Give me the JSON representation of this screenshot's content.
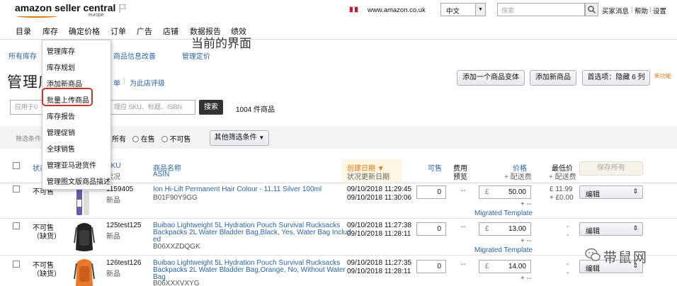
{
  "header": {
    "logo": "amazon seller central",
    "logo_sub": "europe",
    "site_url": "www.amazon.co.uk",
    "language": "中文",
    "search_placeholder": "搜索",
    "links": [
      "买家消息",
      "帮助",
      "设置"
    ],
    "accent_color": "#e47911"
  },
  "nav": [
    "目录",
    "库存",
    "确定价格",
    "订单",
    "广告",
    "店铺",
    "数据报告",
    "绩效"
  ],
  "annotation": "当前的界面",
  "subnav": [
    "所有库存",
    "商品信息改善",
    "管理定价"
  ],
  "dropdown": [
    "管理库存",
    "库存规划",
    "添加新商品",
    "批量上传商品",
    "库存报告",
    "管理促销",
    "全球销售",
    "管理亚马逊货件",
    "管理图文版商品描述"
  ],
  "page": {
    "title": "管理库存",
    "tab_link": "为此店评级",
    "partial_link": "单",
    "buttons": [
      "添加一个商品变体",
      "添加新商品",
      "首选项：隐藏 6 列"
    ],
    "legend_tag": "新功能",
    "search_placeholder": "理应 SKU、标题、ISBN",
    "search_prefix": "应用于0",
    "search_button": "搜索",
    "result_count": "1004 件商品"
  },
  "filter": {
    "label": "筛选条件",
    "options": [
      "所有",
      "在售",
      "不可售"
    ],
    "more_button": "其他筛选条件"
  },
  "columns": {
    "status": "状态",
    "sku": "SKU",
    "sku_sub": "状况",
    "name": "商品名称",
    "asin": "ASIN",
    "created": "创建日期",
    "created_sub": "状况更新日期",
    "available": "可售",
    "fee1": "费用",
    "fee2": "预览",
    "price": "价格",
    "price_sub": "+ 配送费",
    "lowest": "最低价",
    "lowest_sub": "+ 配送费",
    "save": "保存所有"
  },
  "rows": [
    {
      "status": "不可售",
      "status2": "",
      "sku": "1159405",
      "condition": "新品",
      "name": "Ion Hi-Lift Permanent Hair Colour - 11.11 Silver 100ml",
      "name2": "",
      "name3": "",
      "asin": "B01F90Y9GG",
      "created": "09/10/2018 11:29:45",
      "updated": "09/10/2018 11:30:06",
      "qty": "0",
      "currency": "£",
      "price": "50.00",
      "template": "Migrated Template",
      "lowest": "£ 11.99",
      "lowest_ship": "+ £0.00",
      "action": "编辑"
    },
    {
      "status": "不可售",
      "status2": "（缺货）",
      "sku": "125test125",
      "condition": "新品",
      "name": "Buibao Lightweight 5L Hydration Pouch Survival Rucksacks",
      "name2": "Backpacks 2L Water Bladder Bag,Black, Yes, Water Bag Includ",
      "name3": "ed",
      "asin": "B06XXZDQGK",
      "created": "09/10/2018 11:27:38",
      "updated": "09/10/2018 11:28:11",
      "qty": "0",
      "currency": "£",
      "price": "13.00",
      "template": "Migrated Template",
      "lowest": "-",
      "lowest_ship": "-",
      "action": "编辑"
    },
    {
      "status": "不可售",
      "status2": "（缺货）",
      "sku": "126test126",
      "condition": "新品",
      "name": "Buibao Lightweight 5L Hydration Pouch Survival Rucksacks",
      "name2": "Backpacks 2L Water Bladder Bag,Orange, No, Without Water",
      "name3": "Bag",
      "asin": "B06XXXVXYG",
      "created": "09/10/2018 11:27:35",
      "updated": "09/10/2018 11:28:11",
      "qty": "0",
      "currency": "£",
      "price": "14.00",
      "template": "",
      "lowest": "-",
      "lowest_ship": "-",
      "action": "编辑"
    }
  ],
  "common": {
    "dash": "--",
    "plus_dash": "+ --"
  },
  "watermark": "带鼠网"
}
